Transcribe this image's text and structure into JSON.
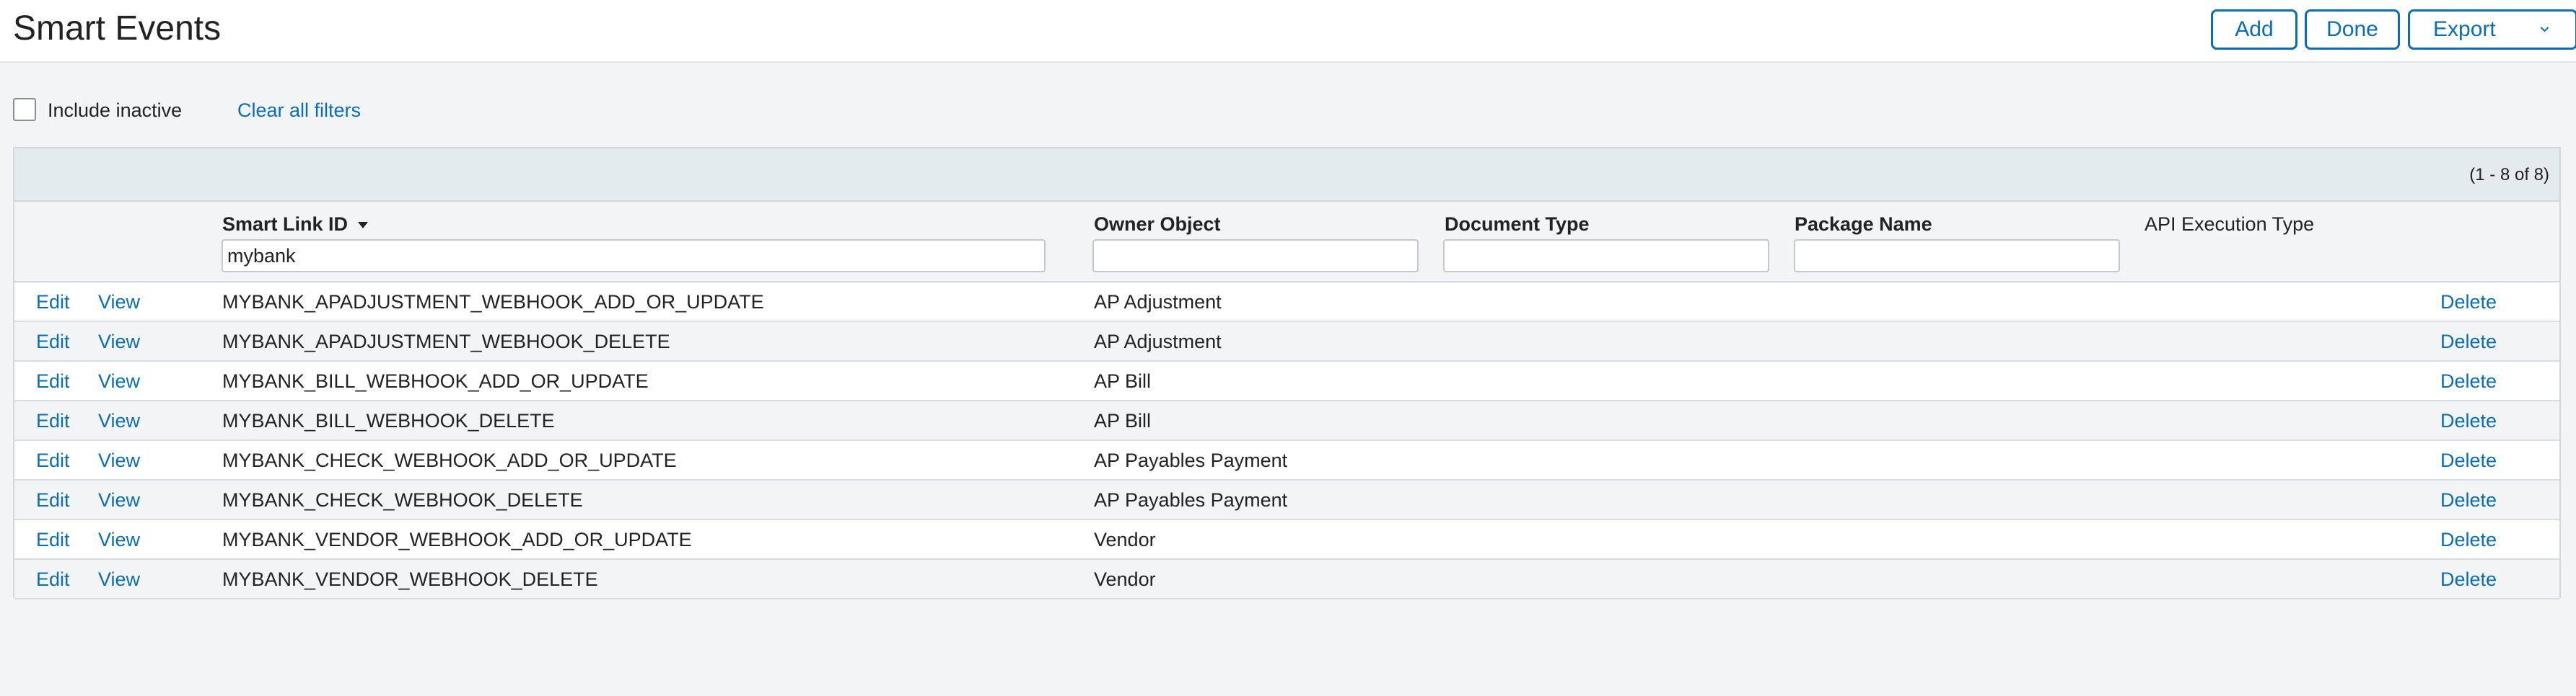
{
  "page": {
    "title": "Smart Events"
  },
  "toolbar": {
    "add_label": "Add",
    "done_label": "Done",
    "export_label": "Export"
  },
  "filters": {
    "include_inactive_label": "Include inactive",
    "include_inactive_checked": false,
    "clear_all_label": "Clear all filters"
  },
  "grid": {
    "record_count": "(1 - 8 of 8)",
    "columns": {
      "smart_link_id": "Smart Link ID",
      "owner_object": "Owner Object",
      "document_type": "Document Type",
      "package_name": "Package Name",
      "api_execution_type": "API Execution Type"
    },
    "column_filters": {
      "smart_link_id": "mybank",
      "owner_object": "",
      "document_type": "",
      "package_name": ""
    },
    "sort": {
      "column": "smart_link_id",
      "direction": "descending-indicator"
    },
    "row_actions": {
      "edit": "Edit",
      "view": "View",
      "delete": "Delete"
    },
    "rows": [
      {
        "id": "MYBANK_APADJUSTMENT_WEBHOOK_ADD_OR_UPDATE",
        "owner": "AP Adjustment"
      },
      {
        "id": "MYBANK_APADJUSTMENT_WEBHOOK_DELETE",
        "owner": "AP Adjustment"
      },
      {
        "id": "MYBANK_BILL_WEBHOOK_ADD_OR_UPDATE",
        "owner": "AP Bill"
      },
      {
        "id": "MYBANK_BILL_WEBHOOK_DELETE",
        "owner": "AP Bill"
      },
      {
        "id": "MYBANK_CHECK_WEBHOOK_ADD_OR_UPDATE",
        "owner": "AP Payables Payment"
      },
      {
        "id": "MYBANK_CHECK_WEBHOOK_DELETE",
        "owner": "AP Payables Payment"
      },
      {
        "id": "MYBANK_VENDOR_WEBHOOK_ADD_OR_UPDATE",
        "owner": "Vendor"
      },
      {
        "id": "MYBANK_VENDOR_WEBHOOK_DELETE",
        "owner": "Vendor"
      }
    ]
  },
  "colors": {
    "accent": "#0a6eb4",
    "background": "#f3f4f6",
    "header_bar": "#e3ebee"
  },
  "icons": {
    "export": "chevron-down-icon",
    "sort": "sort-caret-down-icon"
  }
}
